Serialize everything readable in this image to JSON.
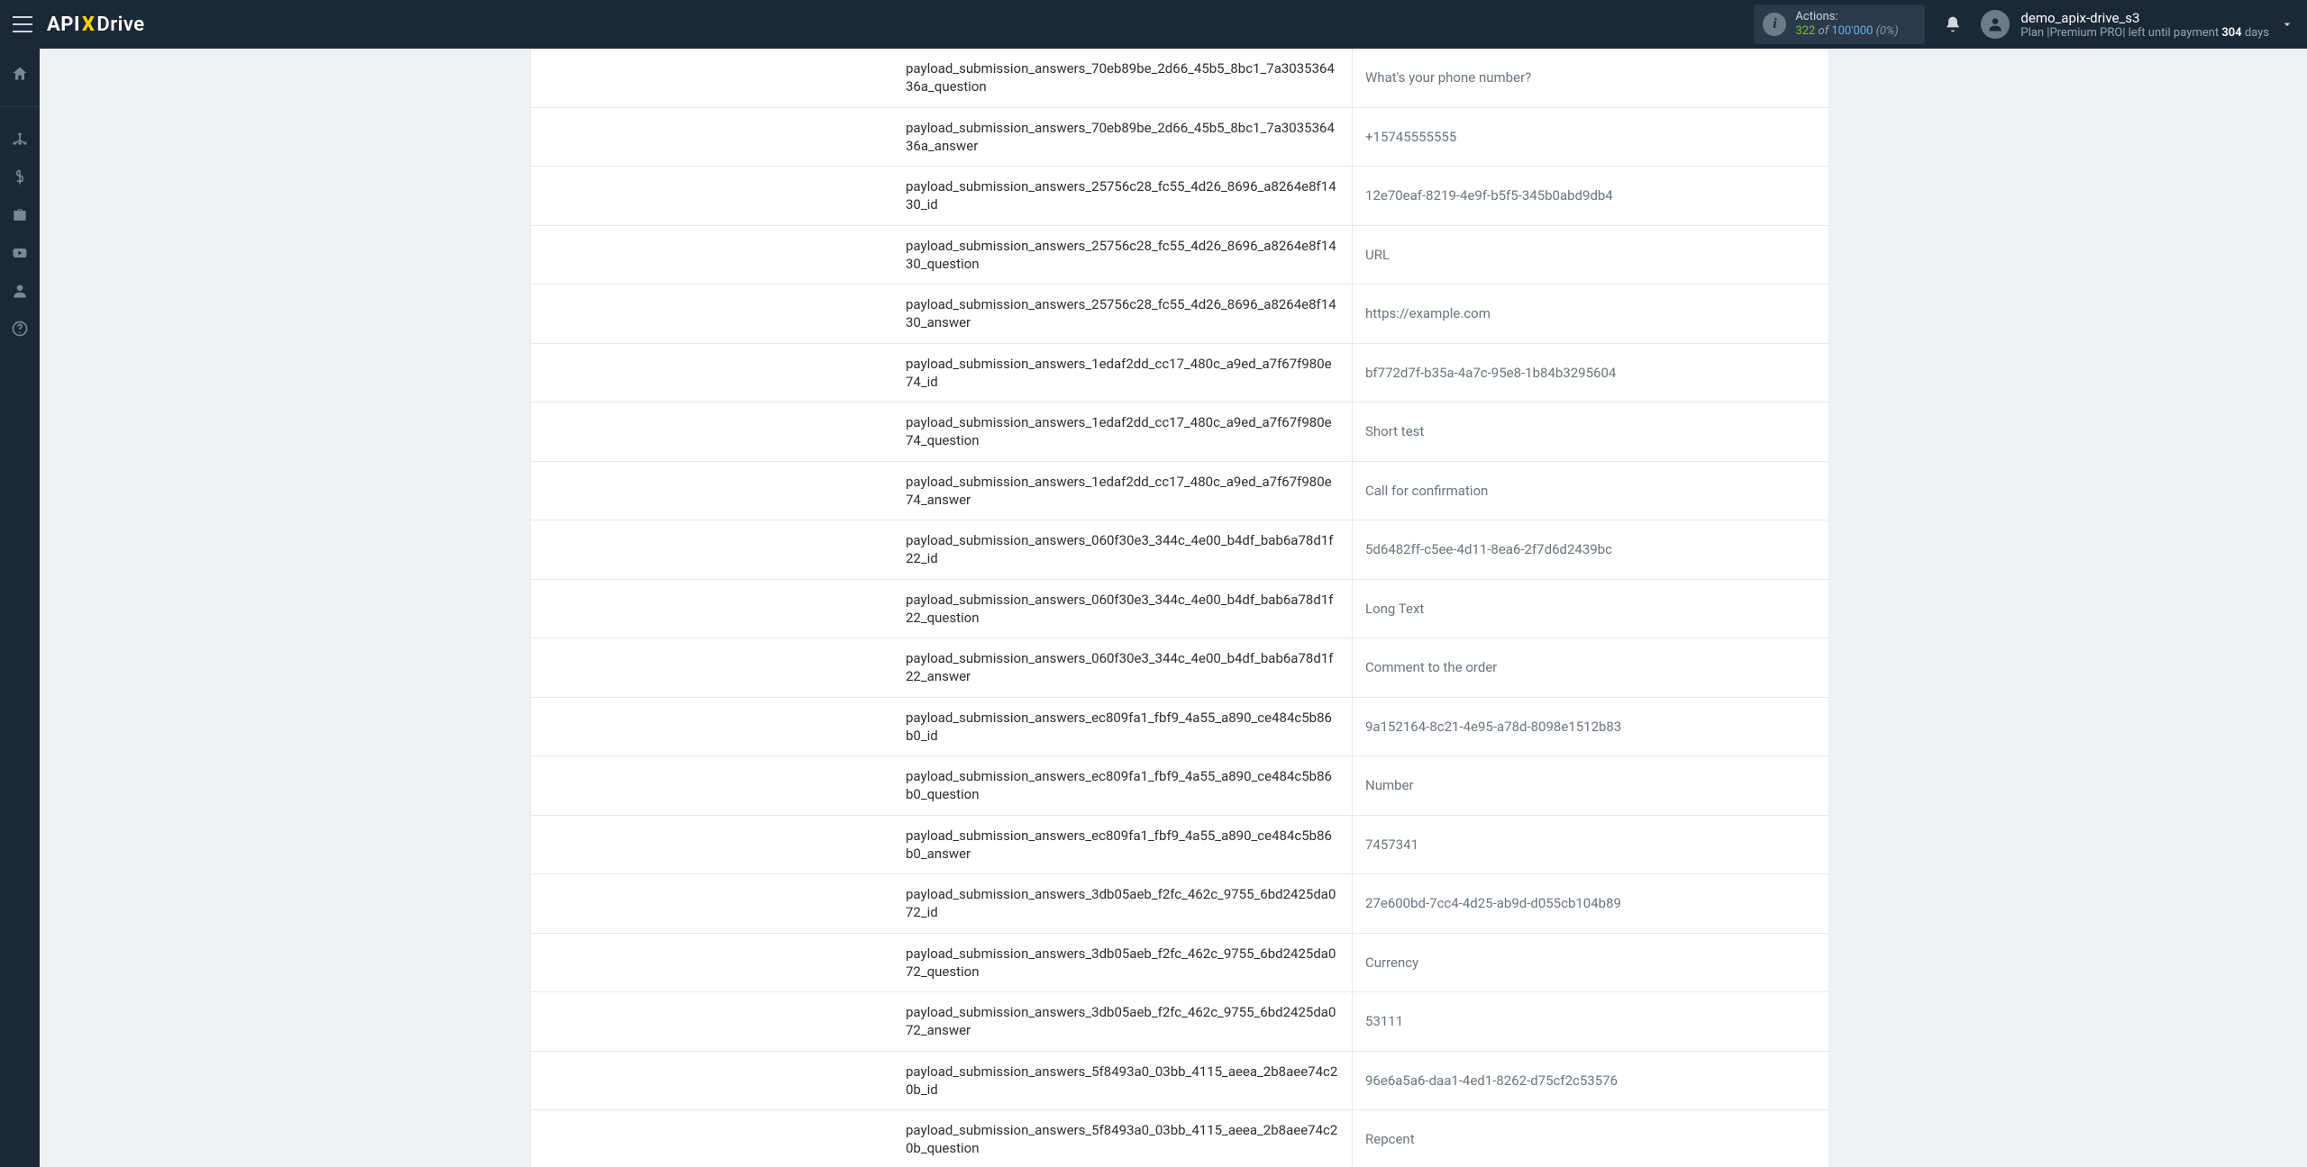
{
  "header": {
    "logo_api": "API",
    "logo_x": "X",
    "logo_drive": "Drive",
    "actions_label": "Actions:",
    "actions_n": "322",
    "actions_of": " of ",
    "actions_max": "100'000",
    "actions_pct": " (0%)",
    "user_name": "demo_apix-drive_s3",
    "plan_prefix": "Plan |",
    "plan_name": "Premium PRO",
    "plan_mid": "| left until payment ",
    "plan_days": "304",
    "plan_days_suffix": " days"
  },
  "rows": [
    {
      "key": "payload_submission_answers_70eb89be_2d66_45b5_8bc1_7a303536436a_question",
      "val": "What's your phone number?"
    },
    {
      "key": "payload_submission_answers_70eb89be_2d66_45b5_8bc1_7a303536436a_answer",
      "val": "+15745555555"
    },
    {
      "key": "payload_submission_answers_25756c28_fc55_4d26_8696_a8264e8f1430_id",
      "val": "12e70eaf-8219-4e9f-b5f5-345b0abd9db4"
    },
    {
      "key": "payload_submission_answers_25756c28_fc55_4d26_8696_a8264e8f1430_question",
      "val": "URL"
    },
    {
      "key": "payload_submission_answers_25756c28_fc55_4d26_8696_a8264e8f1430_answer",
      "val": "https://example.com"
    },
    {
      "key": "payload_submission_answers_1edaf2dd_cc17_480c_a9ed_a7f67f980e74_id",
      "val": "bf772d7f-b35a-4a7c-95e8-1b84b3295604"
    },
    {
      "key": "payload_submission_answers_1edaf2dd_cc17_480c_a9ed_a7f67f980e74_question",
      "val": "Short test"
    },
    {
      "key": "payload_submission_answers_1edaf2dd_cc17_480c_a9ed_a7f67f980e74_answer",
      "val": "Call for confirmation"
    },
    {
      "key": "payload_submission_answers_060f30e3_344c_4e00_b4df_bab6a78d1f22_id",
      "val": "5d6482ff-c5ee-4d11-8ea6-2f7d6d2439bc"
    },
    {
      "key": "payload_submission_answers_060f30e3_344c_4e00_b4df_bab6a78d1f22_question",
      "val": "Long Text"
    },
    {
      "key": "payload_submission_answers_060f30e3_344c_4e00_b4df_bab6a78d1f22_answer",
      "val": "Comment to the order"
    },
    {
      "key": "payload_submission_answers_ec809fa1_fbf9_4a55_a890_ce484c5b86b0_id",
      "val": "9a152164-8c21-4e95-a78d-8098e1512b83"
    },
    {
      "key": "payload_submission_answers_ec809fa1_fbf9_4a55_a890_ce484c5b86b0_question",
      "val": "Number"
    },
    {
      "key": "payload_submission_answers_ec809fa1_fbf9_4a55_a890_ce484c5b86b0_answer",
      "val": "7457341"
    },
    {
      "key": "payload_submission_answers_3db05aeb_f2fc_462c_9755_6bd2425da072_id",
      "val": "27e600bd-7cc4-4d25-ab9d-d055cb104b89"
    },
    {
      "key": "payload_submission_answers_3db05aeb_f2fc_462c_9755_6bd2425da072_question",
      "val": "Currency"
    },
    {
      "key": "payload_submission_answers_3db05aeb_f2fc_462c_9755_6bd2425da072_answer",
      "val": "53111"
    },
    {
      "key": "payload_submission_answers_5f8493a0_03bb_4115_aeea_2b8aee74c20b_id",
      "val": "96e6a5a6-daa1-4ed1-8262-d75cf2c53576"
    },
    {
      "key": "payload_submission_answers_5f8493a0_03bb_4115_aeea_2b8aee74c20b_question",
      "val": "Repcent"
    }
  ]
}
